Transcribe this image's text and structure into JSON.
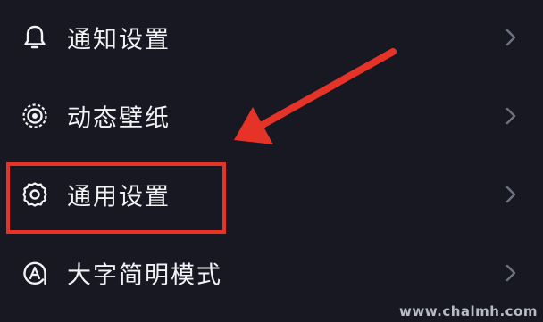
{
  "settings": {
    "items": [
      {
        "label": "通知设置",
        "icon": "bell-icon"
      },
      {
        "label": "动态壁纸",
        "icon": "live-wallpaper-icon"
      },
      {
        "label": "通用设置",
        "icon": "gear-icon"
      },
      {
        "label": "大字简明模式",
        "icon": "large-font-mode-icon"
      }
    ]
  },
  "annotation": {
    "highlighted_item": "通用设置",
    "color": "#e53328"
  },
  "watermark": "www.chalmh.com",
  "colors": {
    "background": "#171822",
    "text": "#f2f2f4",
    "chevron": "#6e7280",
    "annotation": "#e53328"
  }
}
